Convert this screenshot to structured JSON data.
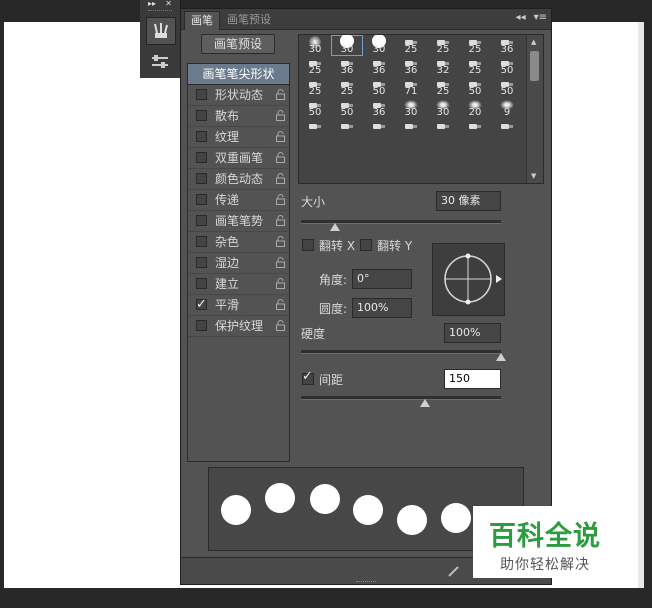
{
  "tabs": {
    "brush": "画笔",
    "brush_presets": "画笔预设"
  },
  "tab_tools": {
    "collapse": "◂◂",
    "menu": "▾≡"
  },
  "dock": {
    "collapse": "▸▸",
    "close": "✕"
  },
  "buttons": {
    "brush_presets": "画笔预设"
  },
  "left_list": {
    "tip_shape": "画笔笔尖形状",
    "options": [
      {
        "label": "形状动态",
        "checked": false
      },
      {
        "label": "散布",
        "checked": false
      },
      {
        "label": "纹理",
        "checked": false
      },
      {
        "label": "双重画笔",
        "checked": false
      },
      {
        "label": "颜色动态",
        "checked": false
      },
      {
        "label": "传递",
        "checked": false
      },
      {
        "label": "画笔笔势",
        "checked": false
      },
      {
        "label": "杂色",
        "checked": false
      },
      {
        "label": "湿边",
        "checked": false
      },
      {
        "label": "建立",
        "checked": false
      },
      {
        "label": "平滑",
        "checked": true
      },
      {
        "label": "保护纹理",
        "checked": false
      }
    ]
  },
  "preset_sizes": [
    [
      "30",
      "30",
      "30",
      "25",
      "25",
      "25",
      "36"
    ],
    [
      "25",
      "36",
      "36",
      "36",
      "32",
      "25",
      "50"
    ],
    [
      "25",
      "25",
      "50",
      "71",
      "25",
      "50",
      "50"
    ],
    [
      "50",
      "50",
      "36",
      "30",
      "30",
      "20",
      "9"
    ],
    [
      "",
      "",
      "",
      "",
      "",
      "",
      ""
    ]
  ],
  "size": {
    "label": "大小",
    "value": "30 像素",
    "slider": 0.17
  },
  "flip_x": {
    "label": "翻转 X"
  },
  "flip_y": {
    "label": "翻转 Y"
  },
  "angle": {
    "label": "角度:",
    "value": "0°"
  },
  "roundness": {
    "label": "圆度:",
    "value": "100%"
  },
  "hardness": {
    "label": "硬度",
    "value": "100%",
    "slider": 1.0
  },
  "spacing": {
    "label": "间距",
    "value": "150",
    "checked": true,
    "slider": 0.62
  },
  "watermark": {
    "title": "百科全说",
    "subtitle": "助你轻松解决"
  },
  "colors": {
    "panel": "#535353",
    "selection": "#6b7a8c",
    "watermark_green": "#2d9b3f"
  }
}
